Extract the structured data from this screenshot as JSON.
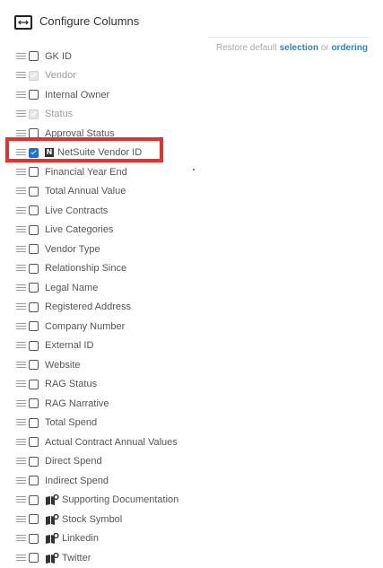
{
  "header": {
    "title": "Configure Columns"
  },
  "restore": {
    "prefix": "Restore default",
    "selection": "selection",
    "or": "or",
    "ordering": "ordering"
  },
  "columns": [
    {
      "label": "GK ID",
      "state": "unchecked",
      "icon": null
    },
    {
      "label": "Vendor",
      "state": "disabled-checked",
      "icon": null
    },
    {
      "label": "Internal Owner",
      "state": "unchecked",
      "icon": null
    },
    {
      "label": "Status",
      "state": "disabled-checked",
      "icon": null
    },
    {
      "label": "Approval Status",
      "state": "unchecked",
      "icon": null
    },
    {
      "label": "NetSuite Vendor ID",
      "state": "checked",
      "icon": "netsuite-icon"
    },
    {
      "label": "Financial Year End",
      "state": "unchecked",
      "icon": null
    },
    {
      "label": "Total Annual Value",
      "state": "unchecked",
      "icon": null
    },
    {
      "label": "Live Contracts",
      "state": "unchecked",
      "icon": null
    },
    {
      "label": "Live Categories",
      "state": "unchecked",
      "icon": null
    },
    {
      "label": "Vendor Type",
      "state": "unchecked",
      "icon": null
    },
    {
      "label": "Relationship Since",
      "state": "unchecked",
      "icon": null
    },
    {
      "label": "Legal Name",
      "state": "unchecked",
      "icon": null
    },
    {
      "label": "Registered Address",
      "state": "unchecked",
      "icon": null
    },
    {
      "label": "Company Number",
      "state": "unchecked",
      "icon": null
    },
    {
      "label": "External ID",
      "state": "unchecked",
      "icon": null
    },
    {
      "label": "Website",
      "state": "unchecked",
      "icon": null
    },
    {
      "label": "RAG Status",
      "state": "unchecked",
      "icon": null
    },
    {
      "label": "RAG Narrative",
      "state": "unchecked",
      "icon": null
    },
    {
      "label": "Total Spend",
      "state": "unchecked",
      "icon": null
    },
    {
      "label": "Actual Contract Annual Values",
      "state": "unchecked",
      "icon": null
    },
    {
      "label": "Direct Spend",
      "state": "unchecked",
      "icon": null
    },
    {
      "label": "Indirect Spend",
      "state": "unchecked",
      "icon": null
    },
    {
      "label": "Supporting Documentation",
      "state": "unchecked",
      "icon": "document-icon"
    },
    {
      "label": "Stock Symbol",
      "state": "unchecked",
      "icon": "document-icon"
    },
    {
      "label": "Linkedin",
      "state": "unchecked",
      "icon": "document-icon"
    },
    {
      "label": "Twitter",
      "state": "unchecked",
      "icon": "document-icon"
    }
  ],
  "colors": {
    "accent": "#2e86c1",
    "checked": "#1f6fd1",
    "highlight": "#e0322f"
  }
}
